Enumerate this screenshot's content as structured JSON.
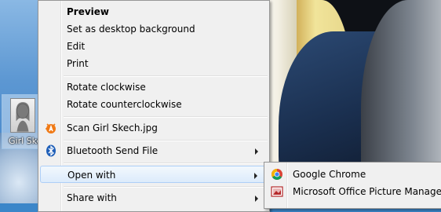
{
  "desktop": {
    "icon_label": "Girl Skech"
  },
  "context_menu": {
    "items": [
      {
        "label": "Preview",
        "bold": true
      },
      {
        "label": "Set as desktop background"
      },
      {
        "label": "Edit"
      },
      {
        "label": "Print"
      },
      {
        "label": "Rotate clockwise"
      },
      {
        "label": "Rotate counterclockwise"
      },
      {
        "label": "Scan Girl Skech.jpg",
        "icon": "avast-icon"
      },
      {
        "label": "Bluetooth Send File",
        "icon": "bluetooth-icon",
        "submenu": true
      },
      {
        "label": "Open with",
        "submenu": true,
        "highlighted": true
      },
      {
        "label": "Share with",
        "submenu": true
      }
    ]
  },
  "open_with_submenu": {
    "items": [
      {
        "label": "Google Chrome",
        "icon": "chrome-icon"
      },
      {
        "label": "Microsoft Office Picture Manager",
        "icon": "picture-manager-icon"
      }
    ]
  },
  "colors": {
    "menu_background": "#f0f0f0",
    "highlight": "#dcebfb",
    "highlight_border": "#aecff7"
  }
}
